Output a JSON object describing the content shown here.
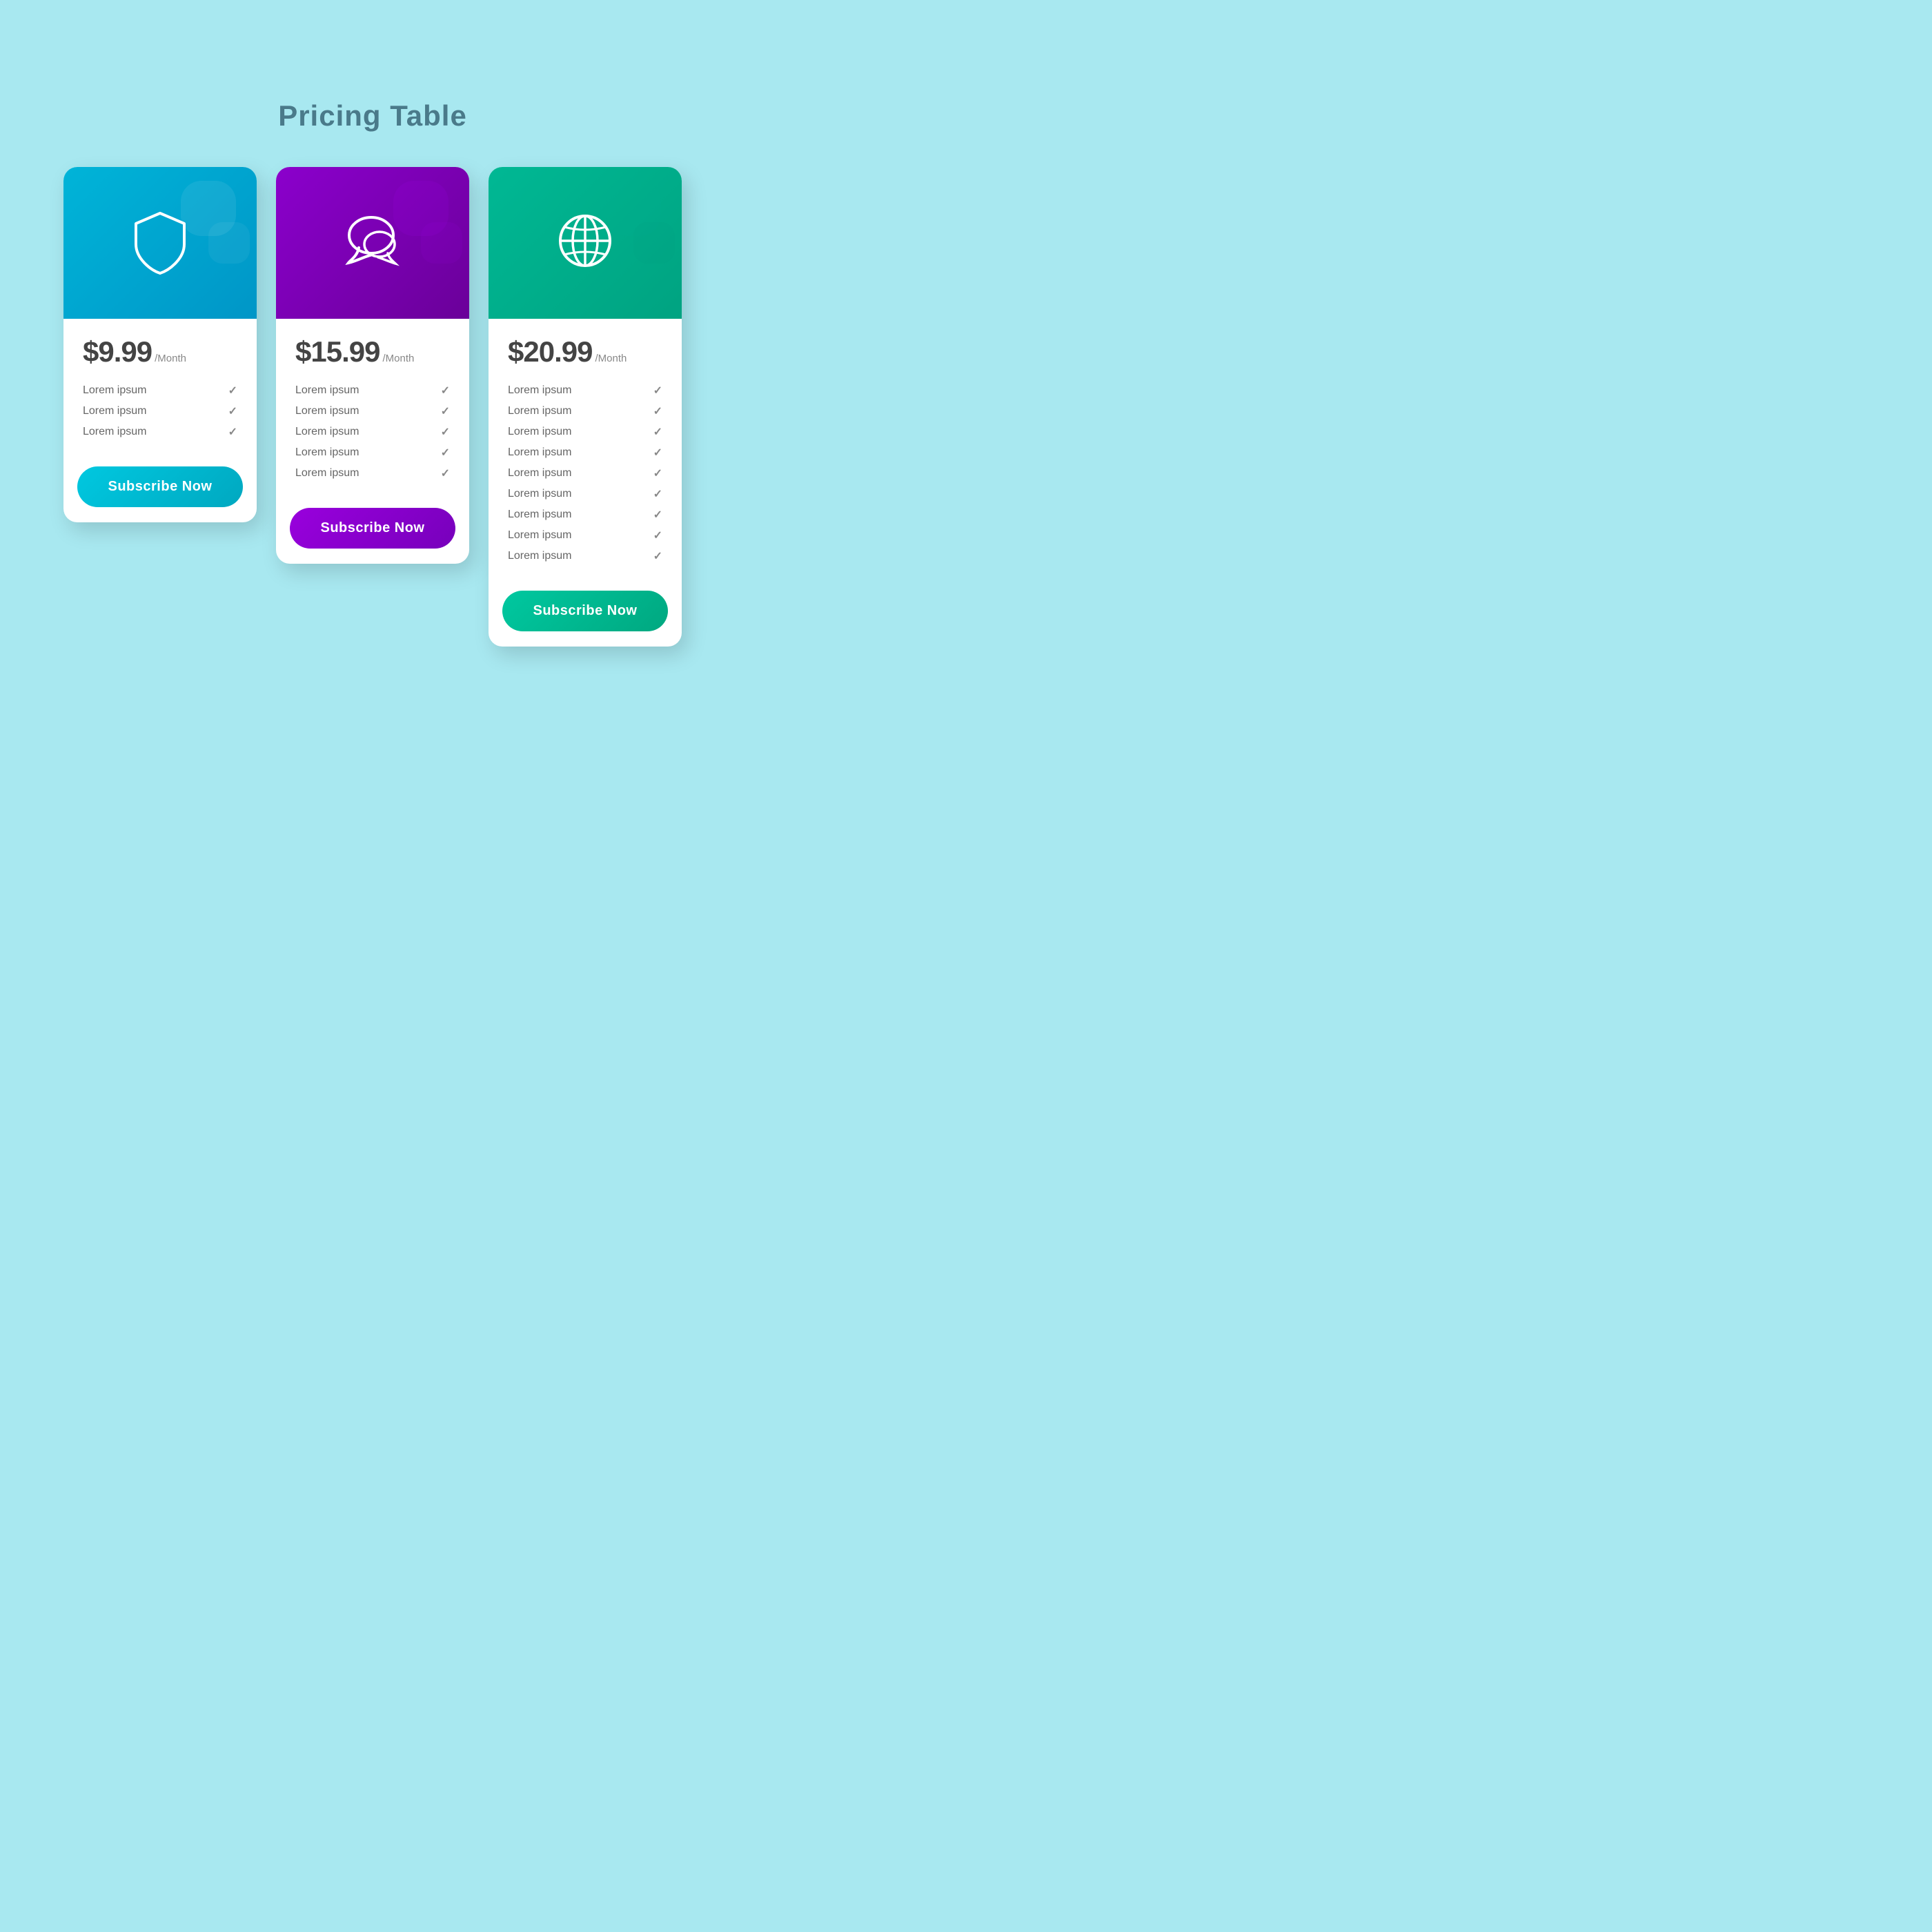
{
  "page": {
    "title": "Pricing Table",
    "background_color": "#a8e8f0"
  },
  "cards": [
    {
      "id": "basic",
      "icon": "shield-icon",
      "price": "$9.99",
      "period": "/Month",
      "header_color_start": "#00b4d8",
      "header_color_end": "#0096c7",
      "button_color": "#00b8d4",
      "button_label": "Subscribe Now",
      "features": [
        {
          "label": "Lorem ipsum"
        },
        {
          "label": "Lorem ipsum"
        },
        {
          "label": "Lorem ipsum"
        }
      ]
    },
    {
      "id": "standard",
      "icon": "chat-icon",
      "price": "$15.99",
      "period": "/Month",
      "header_color_start": "#8b00cc",
      "header_color_end": "#6a0099",
      "button_color": "#8800cc",
      "button_label": "Subscribe Now",
      "features": [
        {
          "label": "Lorem ipsum"
        },
        {
          "label": "Lorem ipsum"
        },
        {
          "label": "Lorem ipsum"
        },
        {
          "label": "Lorem ipsum"
        },
        {
          "label": "Lorem ipsum"
        }
      ]
    },
    {
      "id": "premium",
      "icon": "globe-icon",
      "price": "$20.99",
      "period": "/Month",
      "header_color_start": "#00b894",
      "header_color_end": "#00a381",
      "button_color": "#00b890",
      "button_label": "Subscribe Now",
      "features": [
        {
          "label": "Lorem ipsum"
        },
        {
          "label": "Lorem ipsum"
        },
        {
          "label": "Lorem ipsum"
        },
        {
          "label": "Lorem ipsum"
        },
        {
          "label": "Lorem ipsum"
        },
        {
          "label": "Lorem ipsum"
        },
        {
          "label": "Lorem ipsum"
        },
        {
          "label": "Lorem ipsum"
        },
        {
          "label": "Lorem ipsum"
        }
      ]
    }
  ]
}
